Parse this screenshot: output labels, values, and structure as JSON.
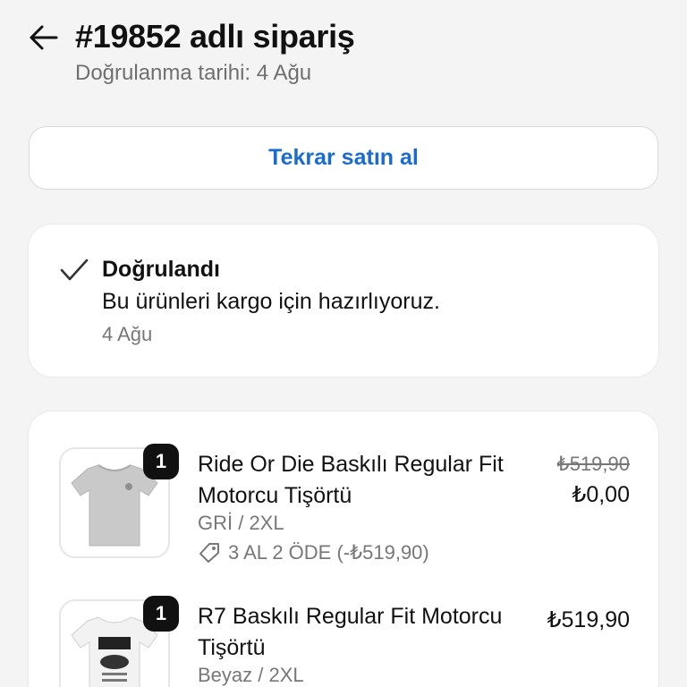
{
  "header": {
    "title": "#19852 adlı sipariş",
    "subtitle": "Doğrulanma tarihi: 4 Ağu"
  },
  "reorder": {
    "label": "Tekrar satın al"
  },
  "status": {
    "title": "Doğrulandı",
    "description": "Bu ürünleri kargo için hazırlıyoruz.",
    "date": "4 Ağu"
  },
  "items": [
    {
      "quantity": "1",
      "name": "Ride Or Die Baskılı Regular Fit Motorcu Tişörtü",
      "variant": "GRİ / 2XL",
      "discount": "3 AL 2 ÖDE (-₺519,90)",
      "price_old": "₺519,90",
      "price_now": "₺0,00"
    },
    {
      "quantity": "1",
      "name": "R7 Baskılı Regular Fit Motorcu Tişörtü",
      "variant": "Beyaz / 2XL",
      "price_now": "₺519,90"
    }
  ],
  "icons": {
    "back": "arrow-left-icon",
    "status": "checkmark-icon",
    "discount": "tag-icon"
  },
  "colors": {
    "accent": "#1a6bd0",
    "background": "#f4f4f4",
    "card": "#ffffff",
    "muted_text": "#777777"
  }
}
